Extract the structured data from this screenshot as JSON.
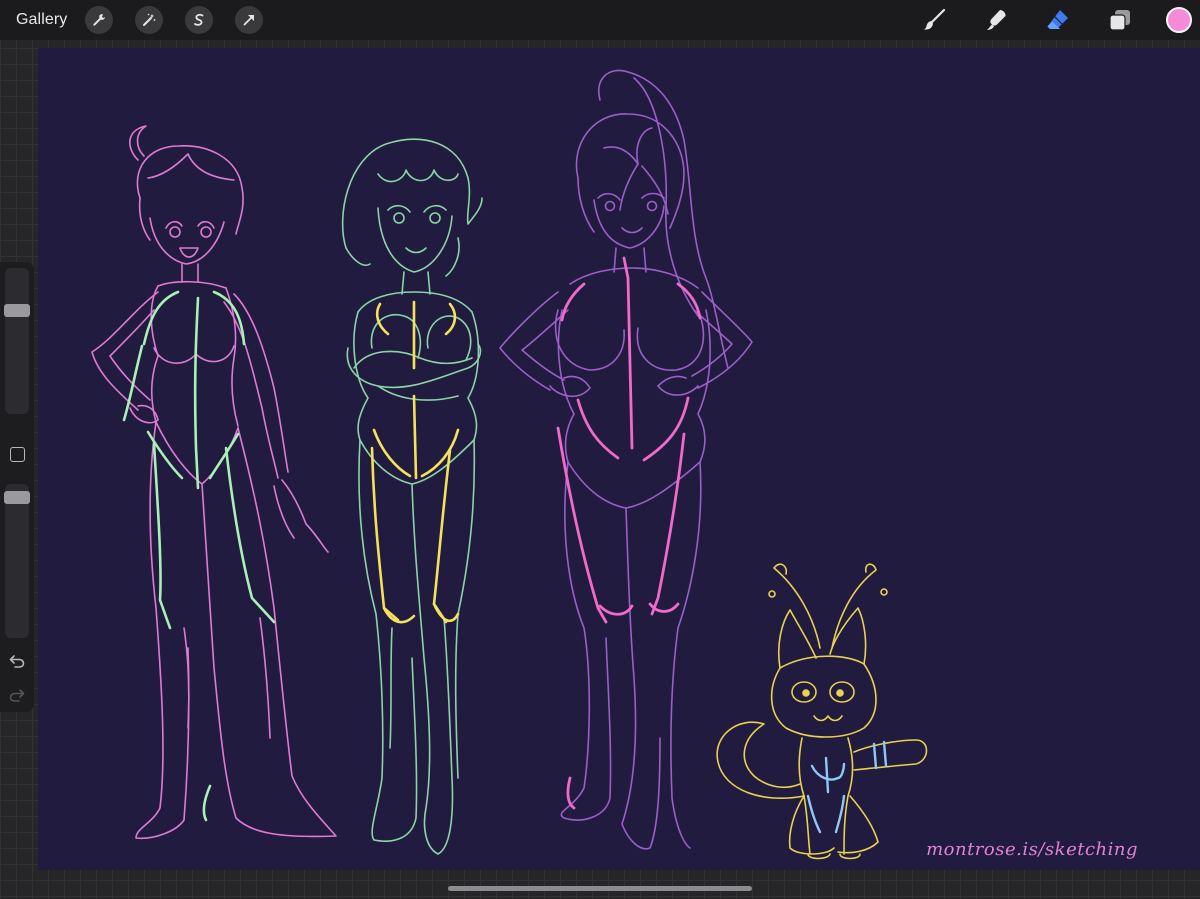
{
  "topbar": {
    "gallery_label": "Gallery",
    "left_tools": [
      "wrench-icon",
      "magic-wand-icon",
      "selection-s-icon",
      "transform-arrow-icon"
    ],
    "right_tools": [
      "brush-icon",
      "smudge-icon",
      "eraser-icon",
      "layers-icon"
    ],
    "active_tool": "eraser-icon",
    "current_color": "#f58bd8",
    "eraser_color": "#3d7bf2"
  },
  "sidebar": {
    "brush_size_level": 0.73,
    "opacity_level": 0.95
  },
  "canvas": {
    "background": "#211b3f",
    "watermark": "montrose.is/sketching"
  }
}
